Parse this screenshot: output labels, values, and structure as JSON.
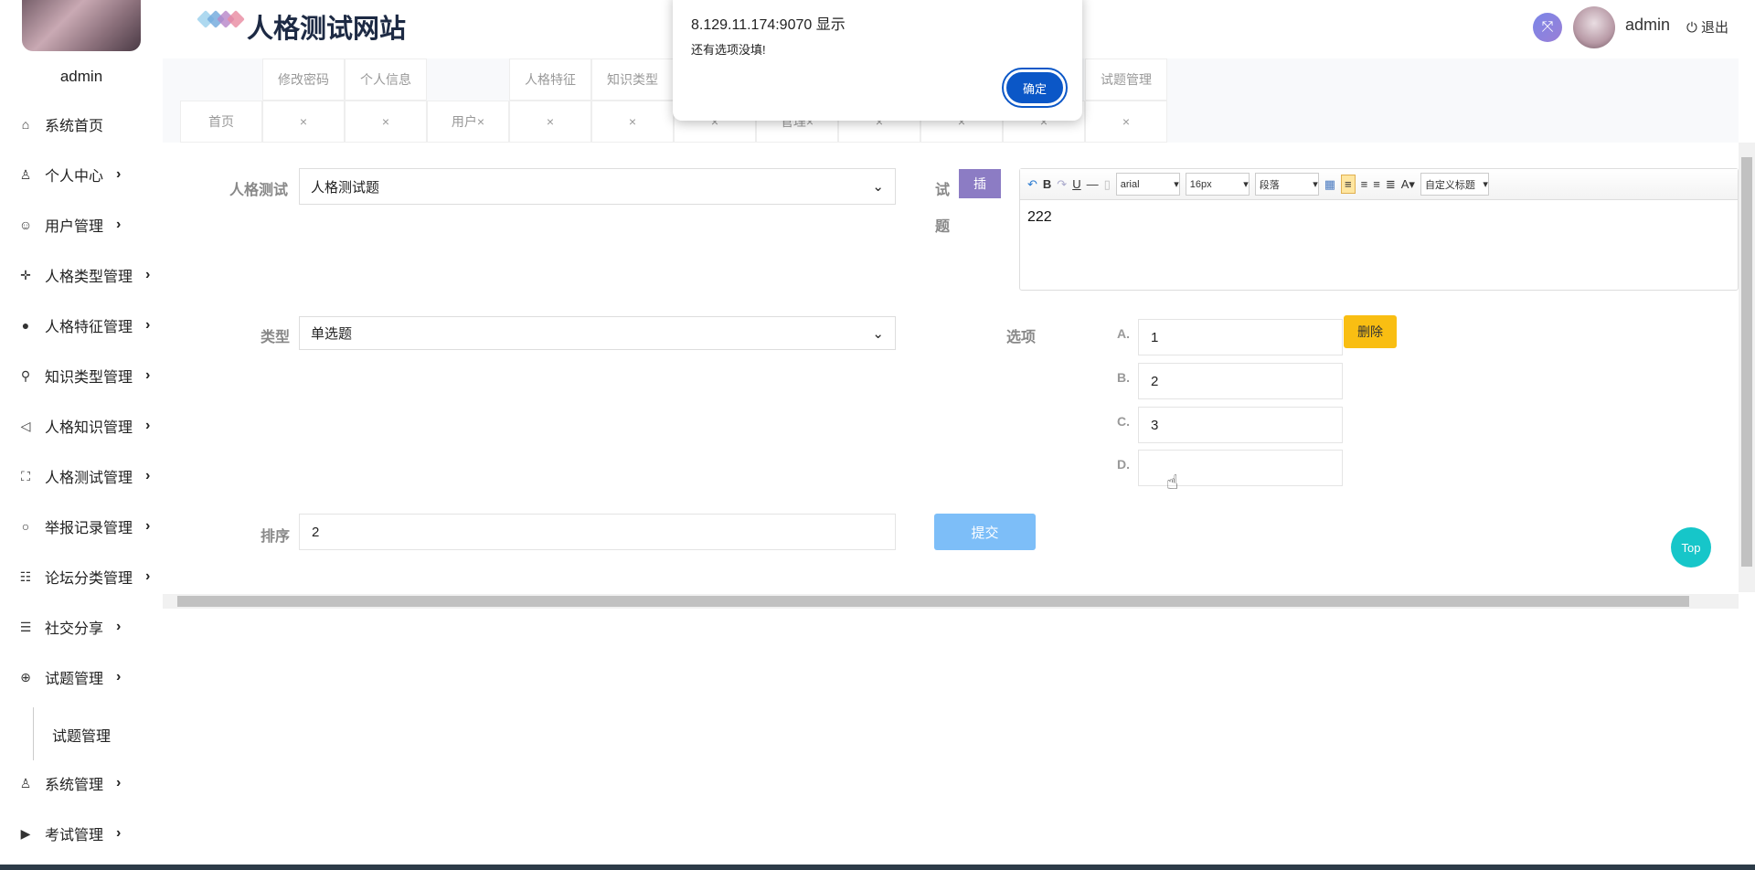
{
  "header": {
    "site_title": "人格测试网站",
    "username": "admin",
    "logout_label": "退出",
    "logo_colors": [
      "#9ad0ec",
      "#6fa8dc",
      "#b784c8",
      "#e88aa0"
    ]
  },
  "sidebar": {
    "username": "admin",
    "items": [
      {
        "label": "系统首页",
        "icon": "home-icon",
        "glyph": "⌂",
        "chevron": false
      },
      {
        "label": "个人中心",
        "icon": "user-icon",
        "glyph": "♙",
        "chevron": true
      },
      {
        "label": "用户管理",
        "icon": "smile-icon",
        "glyph": "☺",
        "chevron": true
      },
      {
        "label": "人格类型管理",
        "icon": "move-icon",
        "glyph": "✛",
        "chevron": true
      },
      {
        "label": "人格特征管理",
        "icon": "user-circle-icon",
        "glyph": "●",
        "chevron": true
      },
      {
        "label": "知识类型管理",
        "icon": "search-key-icon",
        "glyph": "⚲",
        "chevron": true
      },
      {
        "label": "人格知识管理",
        "icon": "speaker-icon",
        "glyph": "◁",
        "chevron": true
      },
      {
        "label": "人格测试管理",
        "icon": "scan-face-icon",
        "glyph": "⛶",
        "chevron": true
      },
      {
        "label": "举报记录管理",
        "icon": "magnifier-icon",
        "glyph": "○",
        "chevron": true
      },
      {
        "label": "论坛分类管理",
        "icon": "category-list-icon",
        "glyph": "☷",
        "chevron": true
      },
      {
        "label": "社交分享",
        "icon": "list-icon",
        "glyph": "☰",
        "chevron": true
      },
      {
        "label": "试题管理",
        "icon": "zoom-in-icon",
        "glyph": "⊕",
        "chevron": true
      },
      {
        "label": "系统管理",
        "icon": "users-icon",
        "glyph": "♙",
        "chevron": true
      },
      {
        "label": "考试管理",
        "icon": "play-icon",
        "glyph": "▶",
        "chevron": true
      }
    ],
    "sub_item": "试题管理"
  },
  "tabs": {
    "top": [
      "修改密码",
      "个人信息",
      "人格特征",
      "知识类型",
      "试题管理"
    ],
    "bottom": [
      "首页",
      "×",
      "×",
      "用户×",
      "×",
      "×",
      "×",
      "管理×",
      "×",
      "×",
      "×",
      "×"
    ]
  },
  "form": {
    "test_label": "人格测试",
    "test_value": "人格测试题",
    "question_label_1": "试",
    "question_label_2": "题",
    "insert_button": "插",
    "editor": {
      "font": "arial",
      "size": "16px",
      "paragraph": "段落",
      "heading": "自定义标题",
      "content": "222"
    },
    "type_label": "类型",
    "type_value": "单选题",
    "options_label": "选项",
    "options": [
      {
        "letter": "A.",
        "value": "1"
      },
      {
        "letter": "B.",
        "value": "2"
      },
      {
        "letter": "C.",
        "value": "3"
      },
      {
        "letter": "D.",
        "value": ""
      }
    ],
    "delete_button": "删除",
    "sort_label": "排序",
    "sort_value": "2",
    "submit_button": "提交"
  },
  "top_button": "Top",
  "dialog": {
    "title": "8.129.11.174:9070 显示",
    "message": "还有选项没填!",
    "ok": "确定"
  }
}
